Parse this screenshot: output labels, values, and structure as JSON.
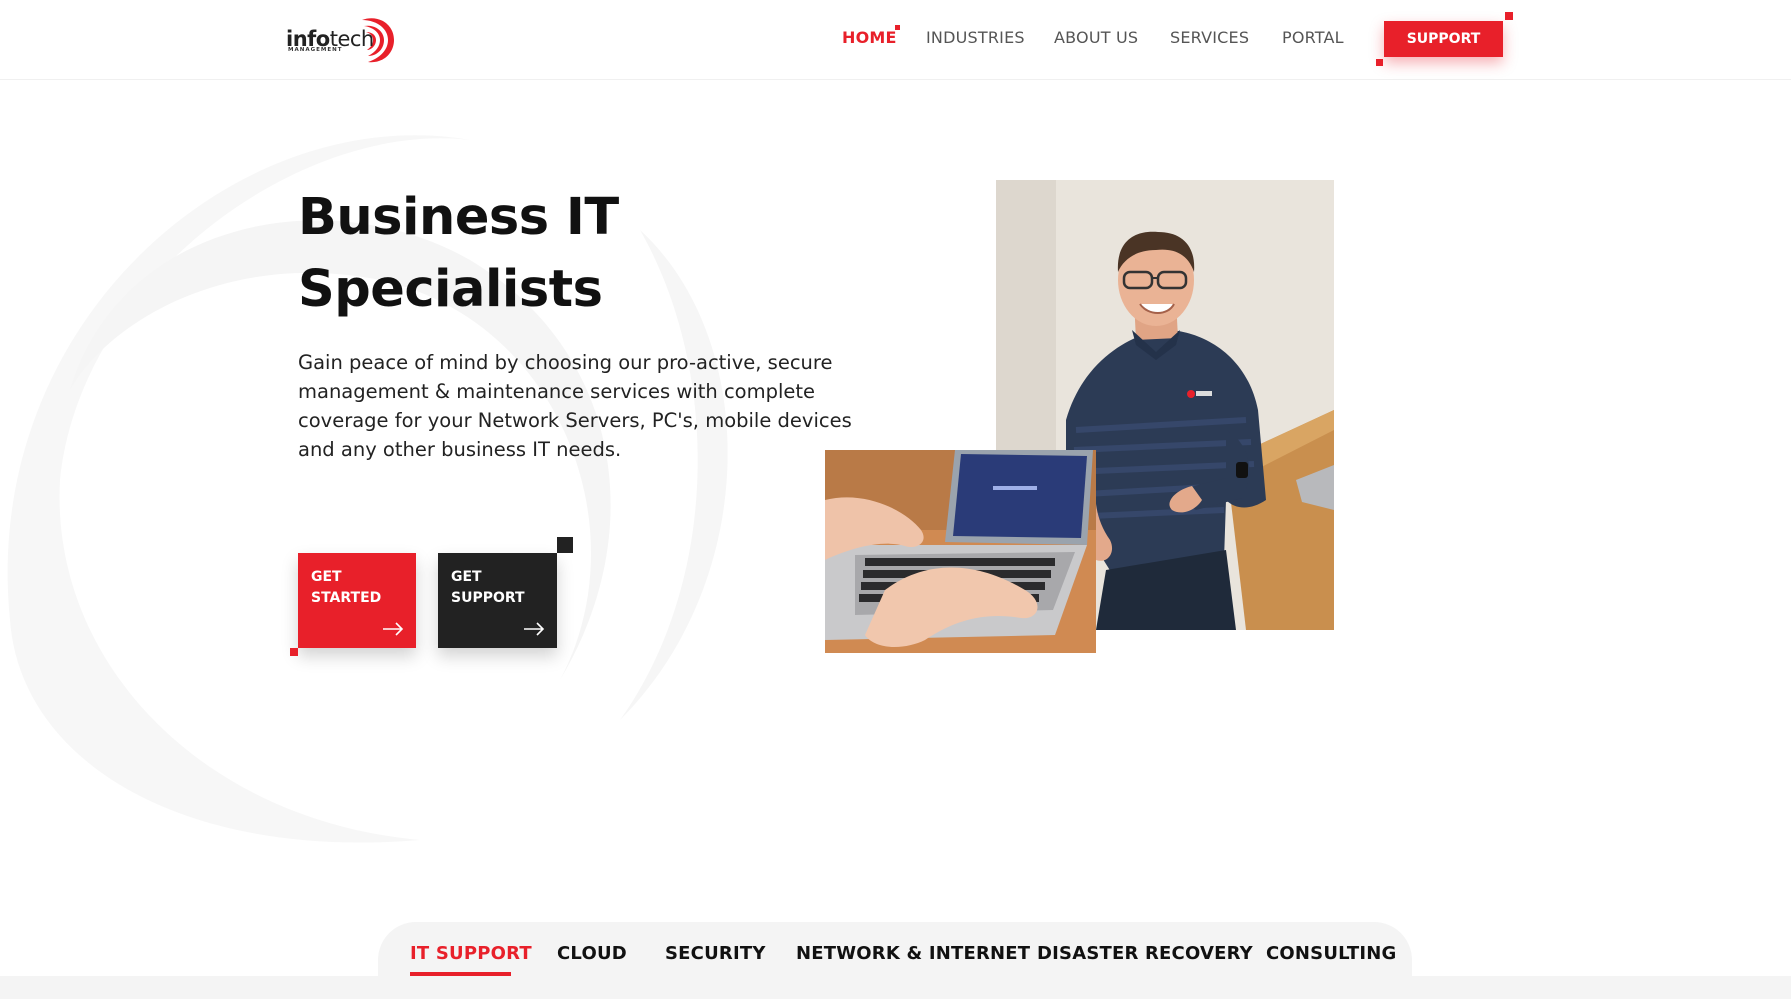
{
  "brand": {
    "logo_main": "info",
    "logo_bold": "tech",
    "logo_sub": "MANAGEMENT",
    "accent_color": "#e8202a",
    "dark_color": "#222222"
  },
  "nav": {
    "items": [
      {
        "label": "HOME",
        "active": true
      },
      {
        "label": "INDUSTRIES",
        "active": false
      },
      {
        "label": "ABOUT US",
        "active": false
      },
      {
        "label": "SERVICES",
        "active": false
      },
      {
        "label": "PORTAL",
        "active": false
      }
    ],
    "support_label": "SUPPORT"
  },
  "hero": {
    "title_line1": "Business IT",
    "title_line2": "Specialists",
    "description": "Gain peace of mind by choosing our pro-active, secure management & maintenance services with complete coverage for your Network Servers, PC's, mobile devices and any other business IT needs.",
    "cta_primary_line1": "GET",
    "cta_primary_line2": "STARTED",
    "cta_secondary_line1": "GET",
    "cta_secondary_line2": "SUPPORT"
  },
  "tabs": [
    {
      "label": "IT SUPPORT",
      "active": true
    },
    {
      "label": "CLOUD",
      "active": false
    },
    {
      "label": "SECURITY",
      "active": false
    },
    {
      "label": "NETWORK & INTERNET",
      "active": false
    },
    {
      "label": "DISASTER RECOVERY",
      "active": false
    },
    {
      "label": "CONSULTING",
      "active": false
    }
  ]
}
